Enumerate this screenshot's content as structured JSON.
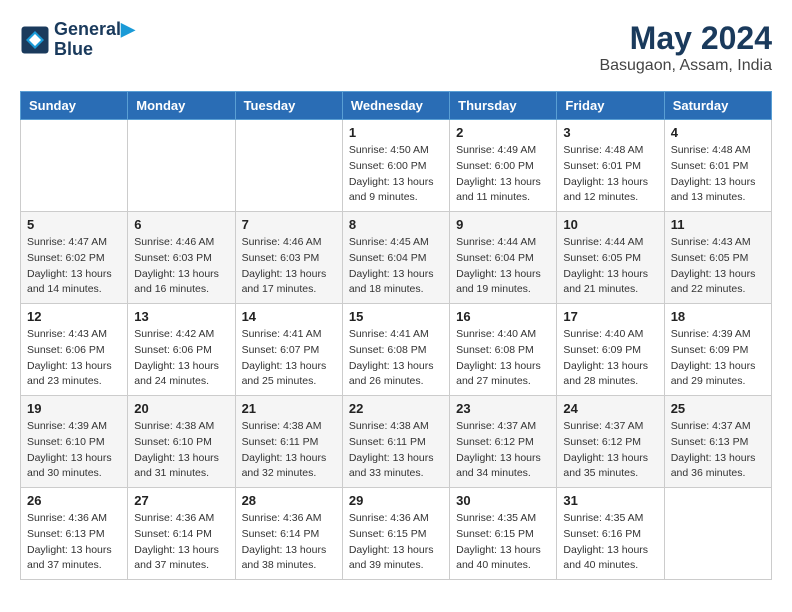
{
  "header": {
    "logo_line1": "General",
    "logo_line2": "Blue",
    "month_year": "May 2024",
    "location": "Basugaon, Assam, India"
  },
  "weekdays": [
    "Sunday",
    "Monday",
    "Tuesday",
    "Wednesday",
    "Thursday",
    "Friday",
    "Saturday"
  ],
  "weeks": [
    [
      {
        "day": "",
        "info": ""
      },
      {
        "day": "",
        "info": ""
      },
      {
        "day": "",
        "info": ""
      },
      {
        "day": "1",
        "info": "Sunrise: 4:50 AM\nSunset: 6:00 PM\nDaylight: 13 hours\nand 9 minutes."
      },
      {
        "day": "2",
        "info": "Sunrise: 4:49 AM\nSunset: 6:00 PM\nDaylight: 13 hours\nand 11 minutes."
      },
      {
        "day": "3",
        "info": "Sunrise: 4:48 AM\nSunset: 6:01 PM\nDaylight: 13 hours\nand 12 minutes."
      },
      {
        "day": "4",
        "info": "Sunrise: 4:48 AM\nSunset: 6:01 PM\nDaylight: 13 hours\nand 13 minutes."
      }
    ],
    [
      {
        "day": "5",
        "info": "Sunrise: 4:47 AM\nSunset: 6:02 PM\nDaylight: 13 hours\nand 14 minutes."
      },
      {
        "day": "6",
        "info": "Sunrise: 4:46 AM\nSunset: 6:03 PM\nDaylight: 13 hours\nand 16 minutes."
      },
      {
        "day": "7",
        "info": "Sunrise: 4:46 AM\nSunset: 6:03 PM\nDaylight: 13 hours\nand 17 minutes."
      },
      {
        "day": "8",
        "info": "Sunrise: 4:45 AM\nSunset: 6:04 PM\nDaylight: 13 hours\nand 18 minutes."
      },
      {
        "day": "9",
        "info": "Sunrise: 4:44 AM\nSunset: 6:04 PM\nDaylight: 13 hours\nand 19 minutes."
      },
      {
        "day": "10",
        "info": "Sunrise: 4:44 AM\nSunset: 6:05 PM\nDaylight: 13 hours\nand 21 minutes."
      },
      {
        "day": "11",
        "info": "Sunrise: 4:43 AM\nSunset: 6:05 PM\nDaylight: 13 hours\nand 22 minutes."
      }
    ],
    [
      {
        "day": "12",
        "info": "Sunrise: 4:43 AM\nSunset: 6:06 PM\nDaylight: 13 hours\nand 23 minutes."
      },
      {
        "day": "13",
        "info": "Sunrise: 4:42 AM\nSunset: 6:06 PM\nDaylight: 13 hours\nand 24 minutes."
      },
      {
        "day": "14",
        "info": "Sunrise: 4:41 AM\nSunset: 6:07 PM\nDaylight: 13 hours\nand 25 minutes."
      },
      {
        "day": "15",
        "info": "Sunrise: 4:41 AM\nSunset: 6:08 PM\nDaylight: 13 hours\nand 26 minutes."
      },
      {
        "day": "16",
        "info": "Sunrise: 4:40 AM\nSunset: 6:08 PM\nDaylight: 13 hours\nand 27 minutes."
      },
      {
        "day": "17",
        "info": "Sunrise: 4:40 AM\nSunset: 6:09 PM\nDaylight: 13 hours\nand 28 minutes."
      },
      {
        "day": "18",
        "info": "Sunrise: 4:39 AM\nSunset: 6:09 PM\nDaylight: 13 hours\nand 29 minutes."
      }
    ],
    [
      {
        "day": "19",
        "info": "Sunrise: 4:39 AM\nSunset: 6:10 PM\nDaylight: 13 hours\nand 30 minutes."
      },
      {
        "day": "20",
        "info": "Sunrise: 4:38 AM\nSunset: 6:10 PM\nDaylight: 13 hours\nand 31 minutes."
      },
      {
        "day": "21",
        "info": "Sunrise: 4:38 AM\nSunset: 6:11 PM\nDaylight: 13 hours\nand 32 minutes."
      },
      {
        "day": "22",
        "info": "Sunrise: 4:38 AM\nSunset: 6:11 PM\nDaylight: 13 hours\nand 33 minutes."
      },
      {
        "day": "23",
        "info": "Sunrise: 4:37 AM\nSunset: 6:12 PM\nDaylight: 13 hours\nand 34 minutes."
      },
      {
        "day": "24",
        "info": "Sunrise: 4:37 AM\nSunset: 6:12 PM\nDaylight: 13 hours\nand 35 minutes."
      },
      {
        "day": "25",
        "info": "Sunrise: 4:37 AM\nSunset: 6:13 PM\nDaylight: 13 hours\nand 36 minutes."
      }
    ],
    [
      {
        "day": "26",
        "info": "Sunrise: 4:36 AM\nSunset: 6:13 PM\nDaylight: 13 hours\nand 37 minutes."
      },
      {
        "day": "27",
        "info": "Sunrise: 4:36 AM\nSunset: 6:14 PM\nDaylight: 13 hours\nand 37 minutes."
      },
      {
        "day": "28",
        "info": "Sunrise: 4:36 AM\nSunset: 6:14 PM\nDaylight: 13 hours\nand 38 minutes."
      },
      {
        "day": "29",
        "info": "Sunrise: 4:36 AM\nSunset: 6:15 PM\nDaylight: 13 hours\nand 39 minutes."
      },
      {
        "day": "30",
        "info": "Sunrise: 4:35 AM\nSunset: 6:15 PM\nDaylight: 13 hours\nand 40 minutes."
      },
      {
        "day": "31",
        "info": "Sunrise: 4:35 AM\nSunset: 6:16 PM\nDaylight: 13 hours\nand 40 minutes."
      },
      {
        "day": "",
        "info": ""
      }
    ]
  ]
}
